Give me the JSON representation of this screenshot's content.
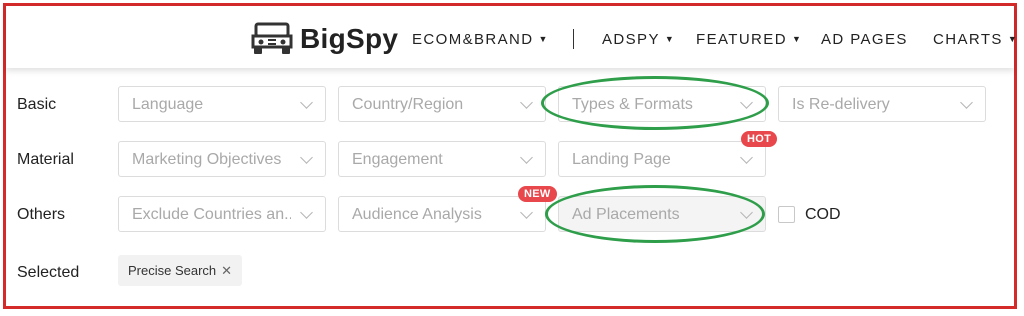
{
  "brand": {
    "name": "BigSpy"
  },
  "nav": {
    "ecom": "ECOM&BRAND",
    "adspy": "ADSPY",
    "featured": "FEATURED",
    "adpages": "AD PAGES",
    "charts": "CHARTS",
    "caret": "▼"
  },
  "filters": {
    "basic": {
      "label": "Basic",
      "language": "Language",
      "country": "Country/Region",
      "types": "Types & Formats",
      "redelivery": "Is Re-delivery"
    },
    "material": {
      "label": "Material",
      "objectives": "Marketing Objectives",
      "engagement": "Engagement",
      "landing": "Landing Page",
      "landing_badge": "HOT"
    },
    "others": {
      "label": "Others",
      "exclude": "Exclude Countries an...",
      "audience": "Audience Analysis",
      "audience_badge": "NEW",
      "placements": "Ad Placements",
      "cod": "COD"
    },
    "selected": {
      "label": "Selected",
      "tag": "Precise Search",
      "tag_close": "✕"
    }
  },
  "colors": {
    "frame": "#d42a2a",
    "highlight": "#2e9e4a",
    "badge": "#e8474b"
  }
}
